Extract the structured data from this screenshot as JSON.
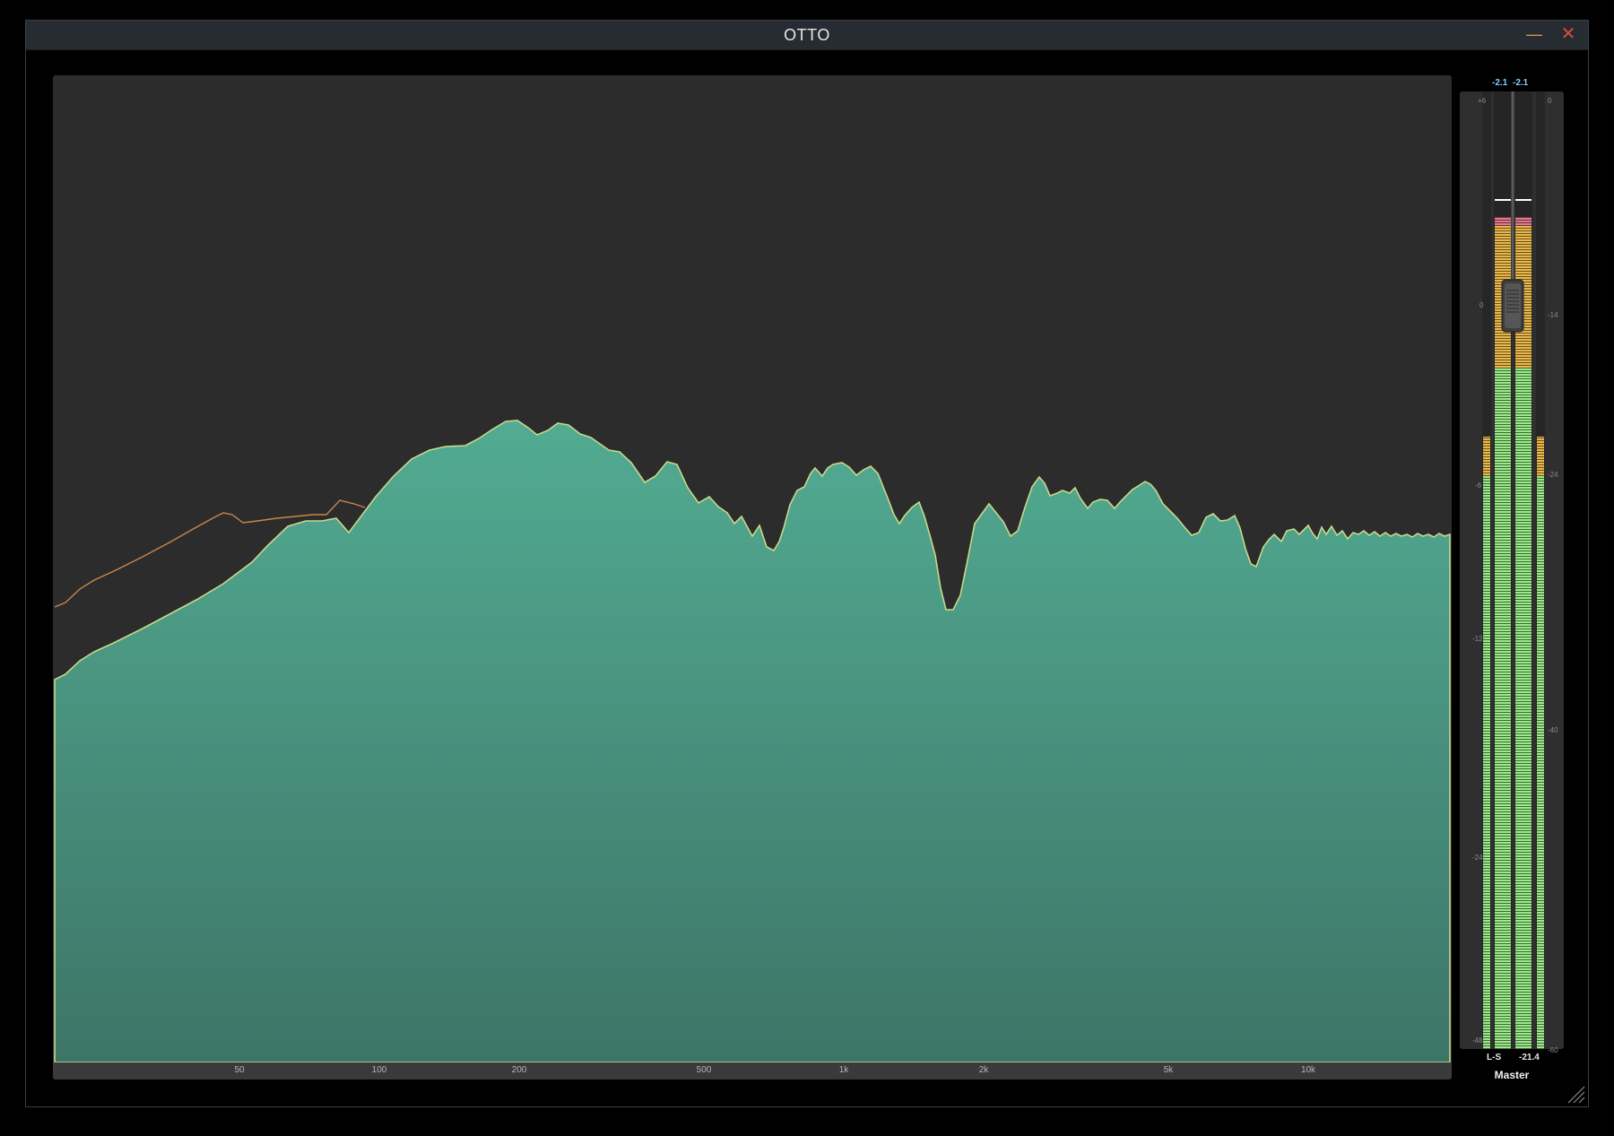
{
  "window": {
    "title": "OTTO",
    "minimize_symbol": "—",
    "close_symbol": "✕"
  },
  "analyzer": {
    "frequency_labels": [
      "50",
      "100",
      "200",
      "500",
      "1k",
      "2k",
      "5k",
      "10k"
    ],
    "colors": {
      "fill": "#4a9c86",
      "line": "#c9d98a",
      "orange": "#c8874a",
      "cyan": "#63e0cc"
    }
  },
  "meter": {
    "peak_left": "-2.1",
    "peak_right": "-2.1",
    "left_scale": [
      "+6",
      "0",
      "-6",
      "-12",
      "-24",
      "-48"
    ],
    "right_scale": [
      "0",
      "-14",
      "-24",
      "-40",
      "-60"
    ],
    "channel_mode": "L-S",
    "level_value": "-21.4",
    "name": "Master"
  }
}
